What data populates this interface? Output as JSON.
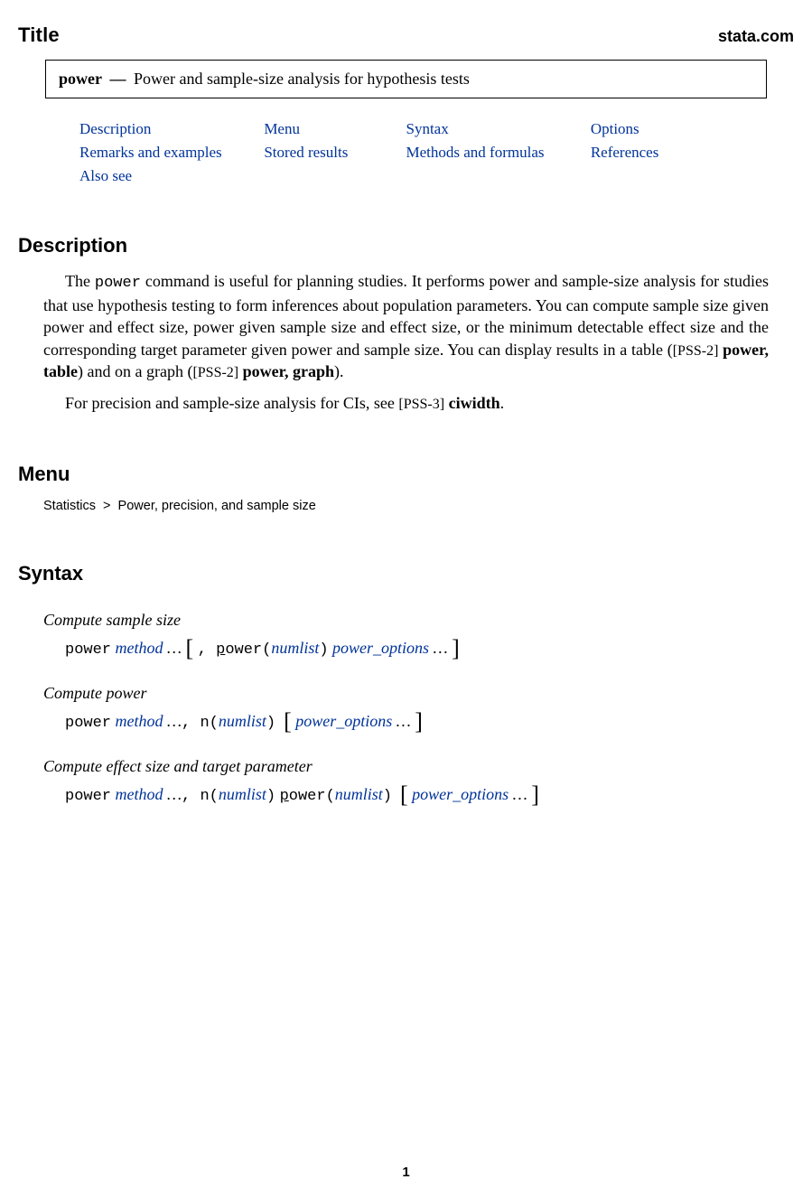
{
  "header": {
    "title": "Title",
    "site": "stata.com"
  },
  "title_box": {
    "cmd": "power",
    "dash": "—",
    "text": "Power and sample-size analysis for hypothesis tests"
  },
  "toc": [
    "Description",
    "Menu",
    "Syntax",
    "Options",
    "Remarks and examples",
    "Stored results",
    "Methods and formulas",
    "References",
    "Also see"
  ],
  "sections": {
    "description": {
      "heading": "Description",
      "p1_a": "The ",
      "p1_cmd": "power",
      "p1_b": " command is useful for planning studies. It performs power and sample-size analysis for studies that use hypothesis testing to form inferences about population parameters. You can compute sample size given power and effect size, power given sample size and effect size, or the minimum detectable effect size and the corresponding target parameter given power and sample size. You can display results in a table (",
      "p1_ref1_tag": "[PSS-2]",
      "p1_ref1": " power, table",
      "p1_c": ") and on a graph (",
      "p1_ref2_tag": "[PSS-2]",
      "p1_ref2": " power, graph",
      "p1_d": ").",
      "p2_a": "For precision and sample-size analysis for CIs, see ",
      "p2_ref_tag": "[PSS-3]",
      "p2_ref": " ciwidth",
      "p2_b": "."
    },
    "menu": {
      "heading": "Menu",
      "path_a": "Statistics",
      "path_sep": ">",
      "path_b": "Power, precision, and sample size"
    },
    "syntax": {
      "heading": "Syntax",
      "blocks": [
        {
          "title": "Compute sample size",
          "parts": {
            "cmd": "power",
            "method": "method",
            "dots1": "…",
            "lb": "[",
            "comma": ", ",
            "opt_ul": "p",
            "opt_rest": "ower",
            "paren_o": "(",
            "numlist": "numlist",
            "paren_c": ")",
            "po": "power_options",
            "dots2": "…",
            "rb": "]"
          }
        },
        {
          "title": "Compute power",
          "parts": {
            "cmd": "power",
            "method": "method",
            "dots1": "…",
            "comma": ", ",
            "n": "n",
            "paren_o": "(",
            "numlist": "numlist",
            "paren_c": ")",
            "lb": "[",
            "po": "power_options",
            "dots2": "…",
            "rb": "]"
          }
        },
        {
          "title": "Compute effect size and target parameter",
          "parts": {
            "cmd": "power",
            "method": "method",
            "dots1": "…",
            "comma": ", ",
            "n": "n",
            "paren_o1": "(",
            "numlist1": "numlist",
            "paren_c1": ")",
            "opt_ul": "p",
            "opt_rest": "ower",
            "paren_o2": "(",
            "numlist2": "numlist",
            "paren_c2": ")",
            "lb": "[",
            "po": "power_options",
            "dots2": "…",
            "rb": "]"
          }
        }
      ]
    }
  },
  "page_number": "1"
}
